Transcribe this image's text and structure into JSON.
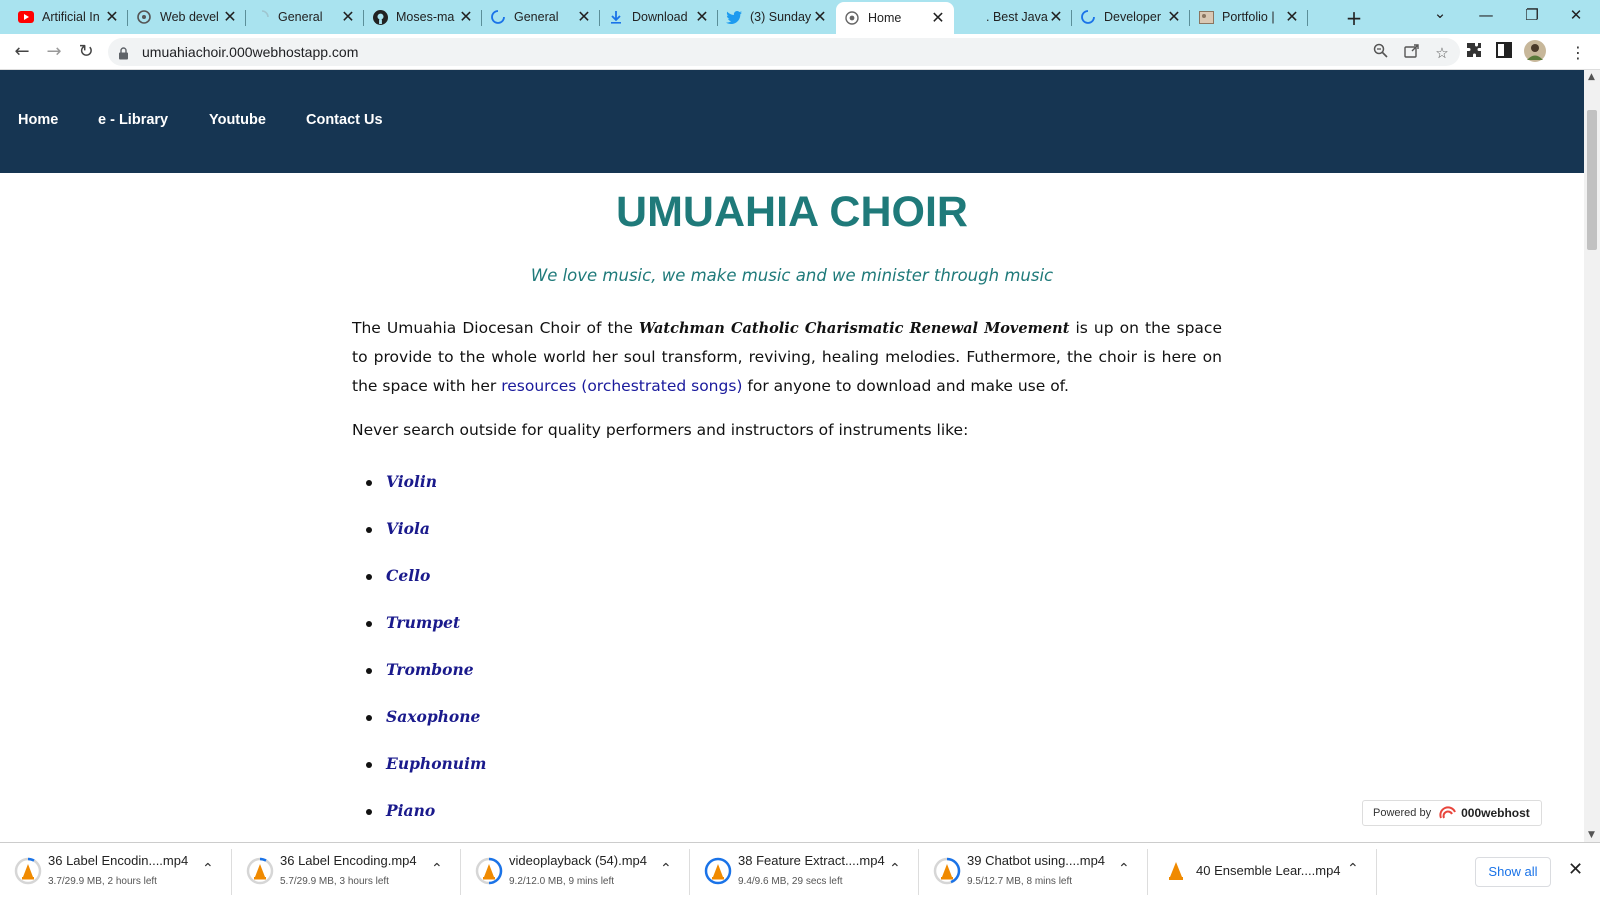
{
  "browser": {
    "tabs": [
      {
        "label": "Artificial In",
        "icon": "youtube-icon",
        "active": false
      },
      {
        "label": "Web devel",
        "icon": "chatgpt-icon",
        "active": false
      },
      {
        "label": "General",
        "icon": "loading-icon",
        "active": false
      },
      {
        "label": "Moses-ma",
        "icon": "github-icon",
        "active": false
      },
      {
        "label": "General",
        "icon": "loading-icon",
        "active": false
      },
      {
        "label": "Download",
        "icon": "download-icon",
        "active": false
      },
      {
        "label": "(3) Sunday",
        "icon": "twitter-icon",
        "active": false
      },
      {
        "label": "Home",
        "icon": "globe-icon",
        "active": true
      },
      {
        "label": ". Best JavaS",
        "icon": "blank-icon",
        "active": false
      },
      {
        "label": "Developer",
        "icon": "loading-icon",
        "active": false
      },
      {
        "label": "Portfolio |",
        "icon": "image-icon",
        "active": false
      }
    ],
    "url": "umuahiachoir.000webhostapp.com"
  },
  "site": {
    "nav": {
      "home": "Home",
      "elibrary": "e - Library",
      "youtube": "Youtube",
      "contact": "Contact Us"
    },
    "title": "UMUAHIA CHOIR",
    "tagline": "We love music, we make music and we minister through music",
    "intro": {
      "part1": "The Umuahia Diocesan Choir of the ",
      "movement": "Watchman Catholic Charismatic Renewal Movement",
      "part2": " is up on the space to provide to the whole world her soul transform, reviving, healing melodies. Futhermore, the choir is here on the space with her ",
      "link": "resources (orchestrated songs)",
      "part3": " for anyone to download and make use of."
    },
    "never_search": "Never search outside for quality performers and instructors of instruments like:",
    "instruments": [
      "Violin",
      "Viola",
      "Cello",
      "Trumpet",
      "Trombone",
      "Saxophone",
      "Euphonuim",
      "Piano"
    ],
    "powered_by": "Powered by",
    "powered_brand": "000webhost"
  },
  "downloads": {
    "items": [
      {
        "name": "36 Label Encodin....mp4",
        "status": "3.7/29.9 MB, 2 hours left"
      },
      {
        "name": "36 Label Encoding.mp4",
        "status": "5.7/29.9 MB, 3 hours left"
      },
      {
        "name": "videoplayback (54).mp4",
        "status": "9.2/12.0 MB, 9 mins left"
      },
      {
        "name": "38 Feature Extract....mp4",
        "status": "9.4/9.6 MB, 29 secs left"
      },
      {
        "name": "39 Chatbot using....mp4",
        "status": "9.5/12.7 MB, 8 mins left"
      },
      {
        "name": "40 Ensemble Lear....mp4",
        "status": ""
      }
    ],
    "show_all": "Show all"
  }
}
